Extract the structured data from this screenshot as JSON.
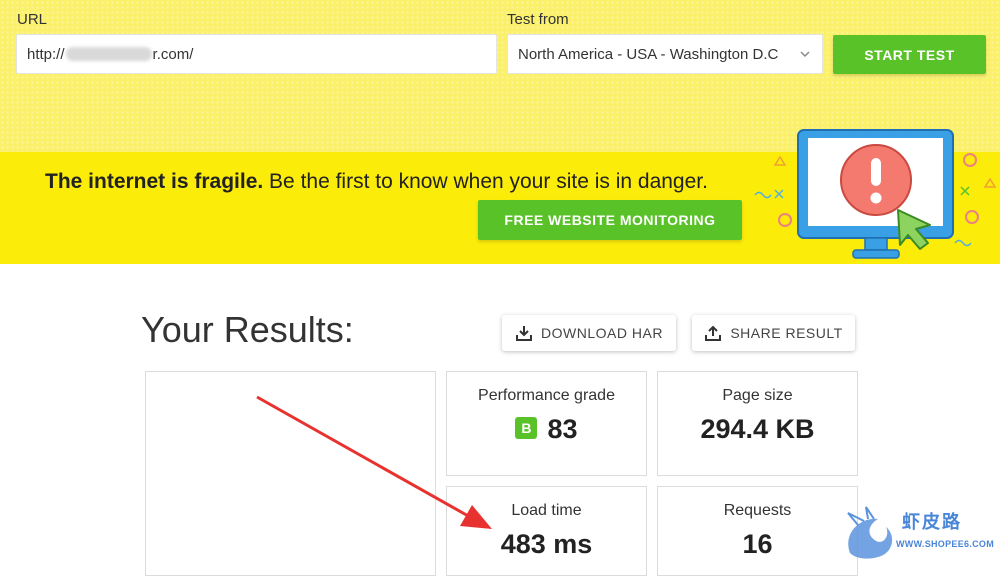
{
  "form": {
    "url_label": "URL",
    "url_prefix": "http://",
    "url_suffix": "r.com/",
    "test_from_label": "Test from",
    "test_from_value": "North America - USA - Washington D.C",
    "start_button": "START TEST"
  },
  "banner": {
    "bold_text": "The internet is fragile.",
    "text": " Be the first to know when your site is in danger.",
    "button": "FREE WEBSITE MONITORING"
  },
  "results": {
    "title": "Your Results:",
    "download_button": "DOWNLOAD HAR",
    "share_button": "SHARE RESULT",
    "performance_label": "Performance grade",
    "performance_grade": "B",
    "performance_value": "83",
    "page_size_label": "Page size",
    "page_size_value": "294.4 KB",
    "load_time_label": "Load time",
    "load_time_value": "483 ms",
    "requests_label": "Requests",
    "requests_value": "16"
  },
  "watermark": {
    "text": "虾皮路",
    "url": "WWW.SHOPEE6.COM"
  },
  "colors": {
    "accent_green": "#5ac229",
    "banner_yellow": "#fbec0a",
    "form_yellow": "#fbf06a",
    "arrow_red": "#e8322f"
  },
  "icons": [
    "chevron-down-icon",
    "download-icon",
    "share-icon",
    "monitor-alert-illustration",
    "cursor-icon",
    "dragon-logo"
  ]
}
